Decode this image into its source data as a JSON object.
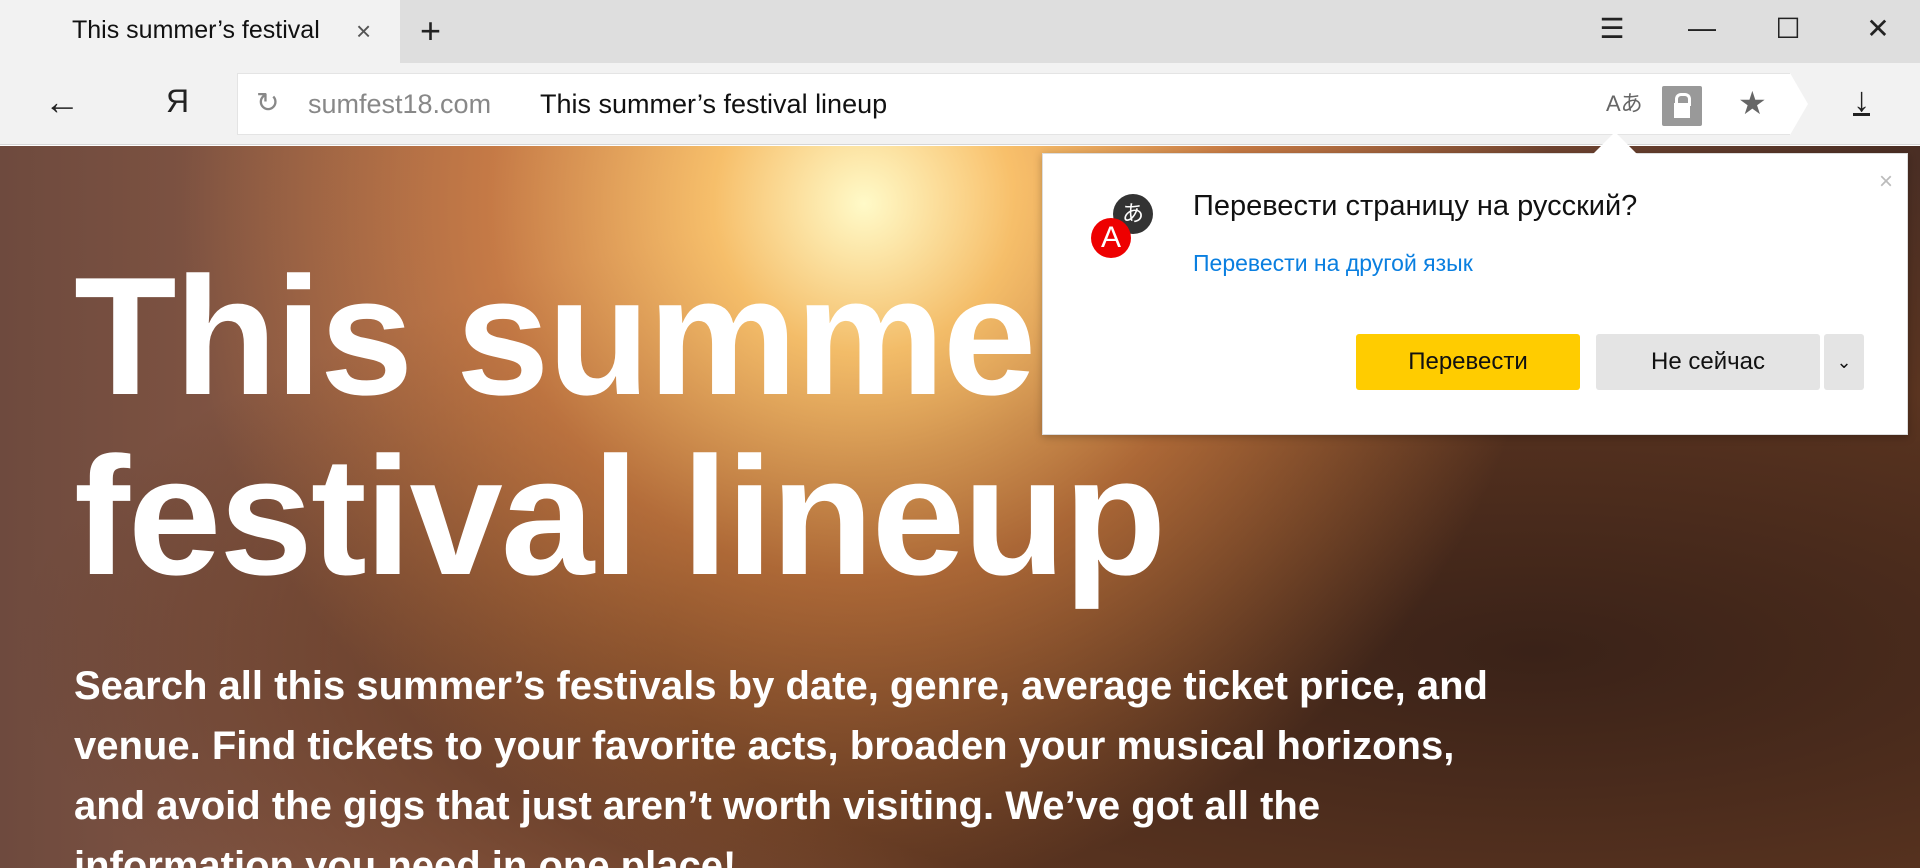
{
  "tab": {
    "title": "This summer’s festival",
    "close": "×",
    "new_tab": "+"
  },
  "window": {
    "menu": "☰",
    "minimize": "—",
    "maximize": "☐",
    "close": "✕"
  },
  "toolbar": {
    "back": "←",
    "yandex": "Я",
    "reload": "↻",
    "domain": "sumfest18.com",
    "page_title": "This summer’s festival lineup",
    "translate_icon": "Aあ",
    "star": "★",
    "download": "↓"
  },
  "hero": {
    "heading": "This summer’s festival lineup",
    "text": "Search all this summer’s festivals by date, genre, average ticket price, and venue. Find tickets to your favorite acts, broaden your musical horizons, and avoid the gigs that just aren’t worth visiting. We’ve got all the information you need in one place!"
  },
  "popup": {
    "icon_a": "A",
    "icon_j": "あ",
    "title": "Перевести страницу на русский?",
    "link": "Перевести на другой язык",
    "translate_button": "Перевести",
    "not_now_button": "Не сейчас",
    "more": "⌄",
    "close": "×",
    "accent": "#ffcc00",
    "link_color": "#0a7fe0"
  }
}
